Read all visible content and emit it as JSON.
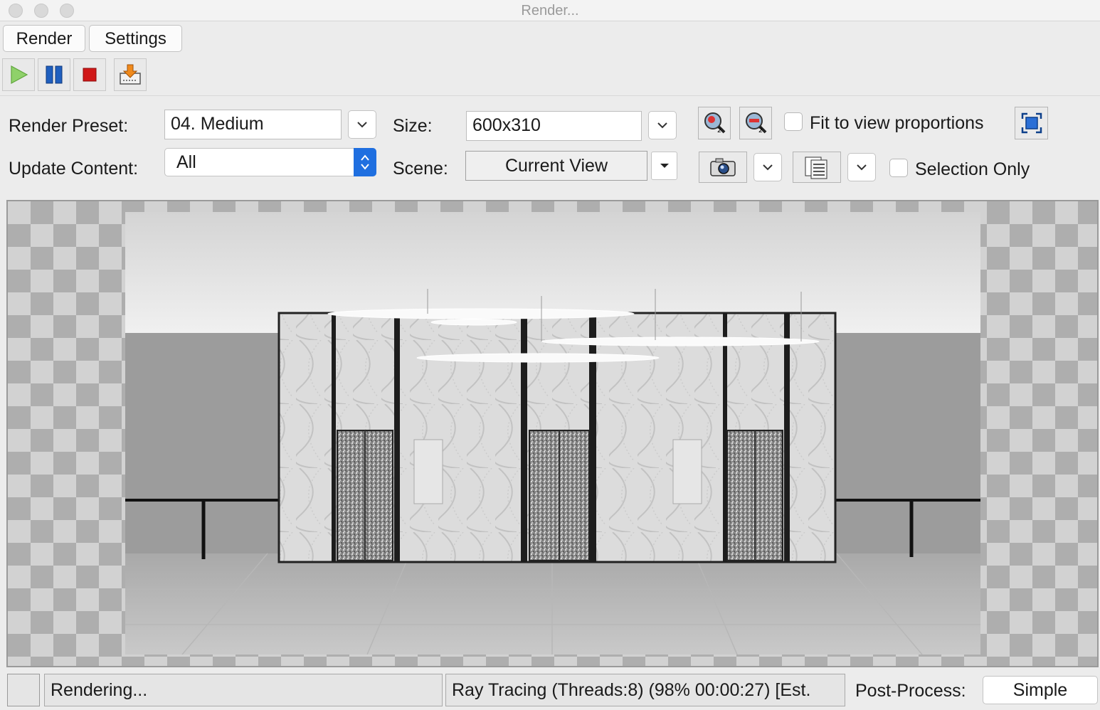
{
  "window": {
    "title": "Render..."
  },
  "tabs": [
    {
      "label": "Render"
    },
    {
      "label": "Settings"
    }
  ],
  "toolbar": {
    "buttons": [
      {
        "icon": "play-icon"
      },
      {
        "icon": "pause-icon"
      },
      {
        "icon": "stop-icon"
      },
      {
        "icon": "export-icon"
      }
    ]
  },
  "settings": {
    "render_preset_label": "Render Preset:",
    "render_preset_value": "04. Medium",
    "update_content_label": "Update Content:",
    "update_content_value": "All",
    "size_label": "Size:",
    "size_value": "600x310",
    "scene_label": "Scene:",
    "scene_value": "Current View",
    "fit_to_view_label": "Fit to view proportions",
    "fit_to_view_checked": false,
    "selection_only_label": "Selection Only",
    "selection_only_checked": false
  },
  "status": {
    "state": "Rendering...",
    "info": "Ray Tracing (Threads:8) (98% 00:00:27) [Est.",
    "postprocess_label": "Post-Process:",
    "postprocess_value": "Simple"
  },
  "colors": {
    "accent_blue": "#1f6fe0",
    "play_green": "#8fd16a",
    "stop_red": "#d01818"
  }
}
